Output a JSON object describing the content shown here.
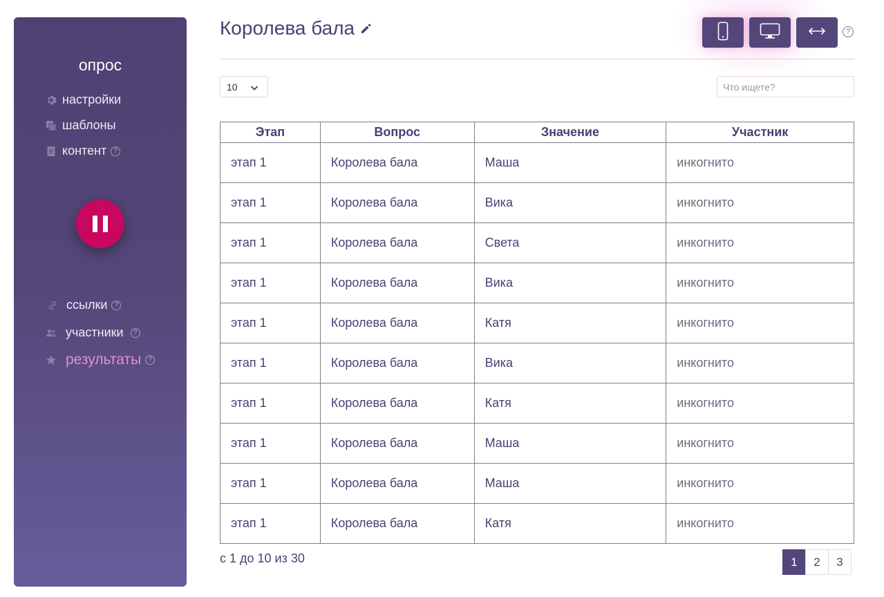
{
  "sidebar": {
    "title": "опрос",
    "items_top": [
      {
        "label": "настройки",
        "icon": "gear-icon"
      },
      {
        "label": "шаблоны",
        "icon": "copy-icon"
      },
      {
        "label": "контент",
        "icon": "document-icon",
        "help": "?"
      }
    ],
    "items_bottom": [
      {
        "label": "ссылки",
        "icon": "link-icon",
        "help": "?"
      },
      {
        "label": "участники",
        "icon": "users-icon",
        "help": "?"
      },
      {
        "label": "результаты",
        "icon": "star-icon",
        "help": "?",
        "active": true
      }
    ],
    "pause_icon": "pause-icon",
    "accent_color": "#c8075f"
  },
  "header": {
    "title": "Королева бала",
    "edit_icon": "pencil-icon",
    "view_buttons": [
      "phone-icon",
      "monitor-icon",
      "arrows-horizontal-icon"
    ],
    "help": "?"
  },
  "controls": {
    "page_size": "10",
    "search_placeholder": "Что ищете?"
  },
  "table": {
    "columns": [
      "Этап",
      "Вопрос",
      "Значение",
      "Участник"
    ],
    "rows": [
      [
        "этап 1",
        "Королева бала",
        "Маша",
        "инкогнито"
      ],
      [
        "этап 1",
        "Королева бала",
        "Вика",
        "инкогнито"
      ],
      [
        "этап 1",
        "Королева бала",
        "Света",
        "инкогнито"
      ],
      [
        "этап 1",
        "Королева бала",
        "Вика",
        "инкогнито"
      ],
      [
        "этап 1",
        "Королева бала",
        "Катя",
        "инкогнито"
      ],
      [
        "этап 1",
        "Королева бала",
        "Вика",
        "инкогнито"
      ],
      [
        "этап 1",
        "Королева бала",
        "Катя",
        "инкогнито"
      ],
      [
        "этап 1",
        "Королева бала",
        "Маша",
        "инкогнито"
      ],
      [
        "этап 1",
        "Королева бала",
        "Маша",
        "инкогнито"
      ],
      [
        "этап 1",
        "Королева бала",
        "Катя",
        "инкогнито"
      ]
    ]
  },
  "footer": {
    "info": "с 1 до 10 из 30",
    "pages": [
      "1",
      "2",
      "3"
    ],
    "active_page": "1"
  },
  "colors": {
    "primary": "#54467a",
    "active_nav": "#e58fd0"
  }
}
